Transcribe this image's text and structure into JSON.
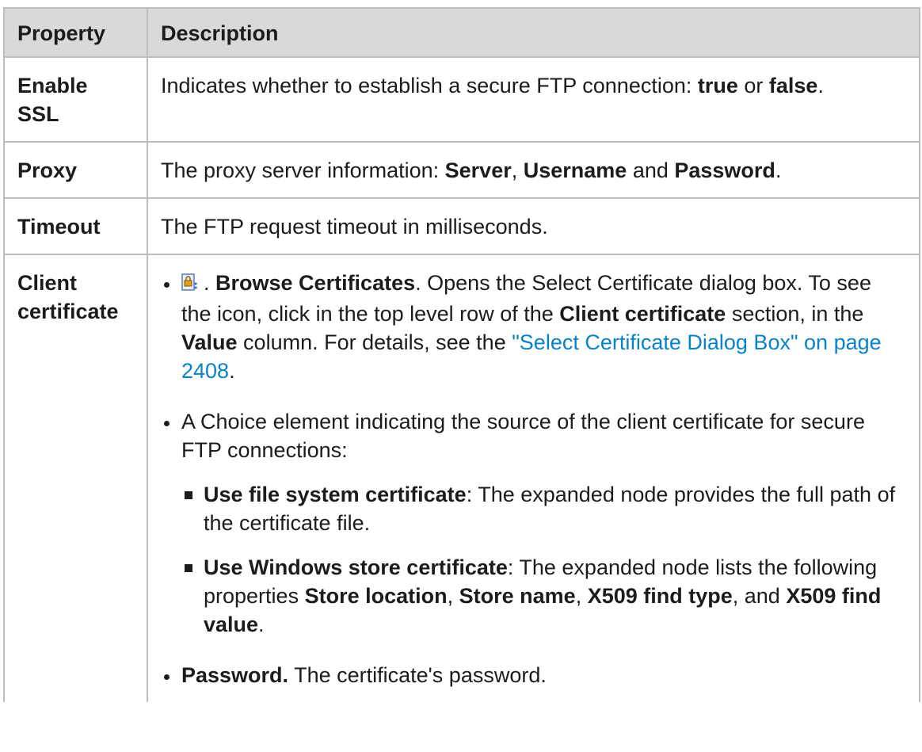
{
  "table": {
    "headers": [
      "Property",
      "Description"
    ],
    "rows": {
      "enable_ssl": {
        "property": "Enable SSL",
        "desc_pre": "Indicates whether to establish a secure FTP connection: ",
        "true_label": "true",
        "or": " or ",
        "false_label": "false",
        "end": "."
      },
      "proxy": {
        "property": "Proxy",
        "desc_pre": "The proxy server information: ",
        "server": "Server",
        "comma": ", ",
        "username": "Username",
        "and": " and ",
        "password": "Password",
        "end": "."
      },
      "timeout": {
        "property": "Timeout",
        "desc": "The FTP request timeout in milliseconds."
      },
      "client_certificate": {
        "property_line1": "Client",
        "property_line2": "certificate",
        "browse": {
          "icon": "browse-certificates-icon",
          "sep": ". ",
          "label": "Browse Certificates",
          "text1": ". Opens the Select Certificate dialog box. To see the icon, click in the top level row of the ",
          "client_certificate": "Client certificate",
          "text2": " section, in the ",
          "value": "Value",
          "text3": " column. For details, see the ",
          "link": "\"Select Certificate Dialog Box\" on page 2408",
          "end": "."
        },
        "choice": {
          "text": "A Choice element indicating the source of the client certificate for secure FTP connections:",
          "file_system": {
            "label": "Use file system certificate",
            "text": ": The expanded node provides the full path of the certificate file."
          },
          "windows_store": {
            "label": "Use Windows store certificate",
            "text1": ": The expanded node lists the following properties ",
            "store_location": "Store location",
            "comma1": ", ",
            "store_name": "Store name",
            "comma2": ", ",
            "find_type": "X509 find type",
            "and": ", and ",
            "find_value": "X509 find value",
            "end": "."
          }
        },
        "password": {
          "label": "Password.",
          "text": " The certificate's password."
        }
      }
    }
  }
}
